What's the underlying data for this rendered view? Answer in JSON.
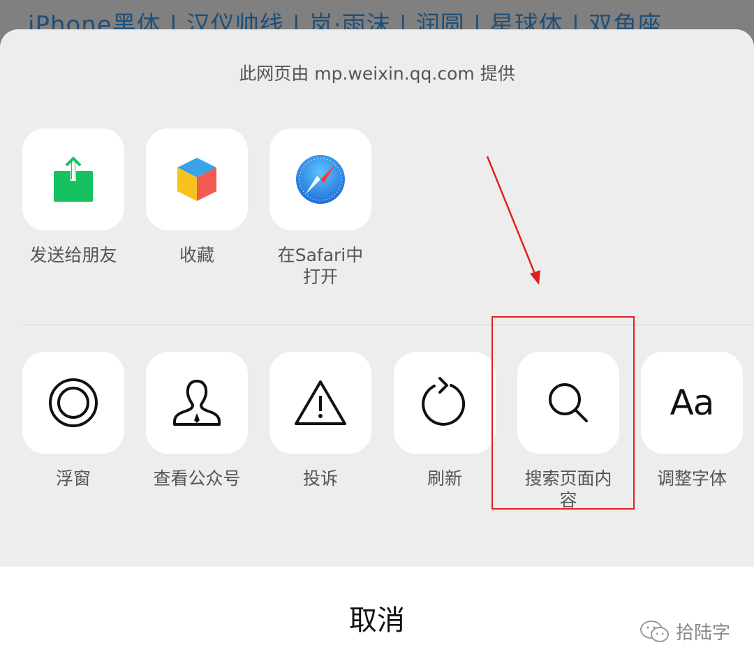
{
  "background": {
    "text": "iPhone黑体 | 汉仪帅线 | 岚·雨沫 | 润圆 | 星球体 | 双角座"
  },
  "sheet": {
    "provider_text": "此网页由 mp.weixin.qq.com 提供",
    "row1": [
      {
        "label": "发送给朋友",
        "icon": "share-icon"
      },
      {
        "label": "收藏",
        "icon": "favorite-cube-icon"
      },
      {
        "label": "在Safari中\n打开",
        "icon": "safari-compass-icon"
      }
    ],
    "row2": [
      {
        "label": "浮窗",
        "icon": "floating-window-icon"
      },
      {
        "label": "查看公众号",
        "icon": "official-account-icon"
      },
      {
        "label": "投诉",
        "icon": "warning-icon"
      },
      {
        "label": "刷新",
        "icon": "refresh-icon"
      },
      {
        "label": "搜索页面内容",
        "icon": "search-icon"
      },
      {
        "label": "调整字体",
        "icon": "font-size-icon",
        "glyph": "Aa"
      }
    ],
    "cancel_label": "取消"
  },
  "watermark": {
    "text": "拾陆字"
  },
  "colors": {
    "accent_red": "#e02020",
    "share_green": "#16c160",
    "safari_blue": "#2f8fe8"
  }
}
